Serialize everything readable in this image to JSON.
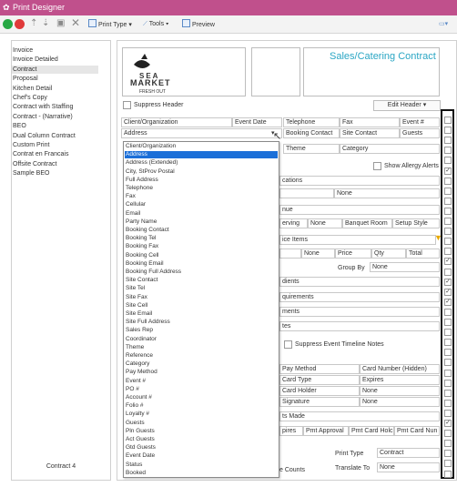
{
  "window": {
    "title": "Print Designer"
  },
  "toolbar": {
    "print_type": "Print Type",
    "tools": "Tools",
    "preview": "Preview"
  },
  "left_panel": {
    "items": [
      "Invoice",
      "Invoice Detailed",
      "Contract",
      "Proposal",
      "Kitchen Detail",
      "Chef's Copy",
      "Contract with Staffing",
      "Contract - (Narrative)",
      "BEO",
      "Dual Column Contract",
      "Custom Print",
      "Contrat en Francais",
      "Offsite Contract",
      "Sample BEO"
    ],
    "selected": "Contract",
    "footer": "Contract 4"
  },
  "header": {
    "logo_line1": "SEA",
    "logo_line2": "MARKET",
    "logo_line3": "FRESH OUT",
    "title": "Sales/Catering Contract",
    "suppress_header": "Suppress Header",
    "edit_header": "Edit Header"
  },
  "grid": {
    "client_org": "Client/Organization",
    "event_date": "Event Date",
    "telephone": "Telephone",
    "fax": "Fax",
    "event_num": "Event #",
    "address": "Address",
    "booking_contact": "Booking Contact",
    "site_contact": "Site Contact",
    "guests": "Guests",
    "theme": "Theme",
    "category": "Category",
    "show_allergy": "Show Allergy Alerts",
    "locations": "cations",
    "none": "None",
    "venue": "nue",
    "serving": "erving",
    "banquet_room": "Banquet Room",
    "setup_style": "Setup Style",
    "invoice_items": "ice Items",
    "price": "Price",
    "qty": "Qty",
    "total": "Total",
    "group_by": "Group By",
    "ingredients": "dients",
    "requirements": "quirements",
    "comments": "ments",
    "notes": "tes",
    "suppress_timeline": "Suppress Event Timeline Notes",
    "pay_method": "Pay Method",
    "card_number_hidden": "Card Number (Hidden)",
    "card_type": "Card Type",
    "expires": "Expires",
    "card_holder": "Card Holder",
    "signature": "Signature",
    "payments_made": "ts Made",
    "expires2": "pires",
    "pmt_approval": "Pmt Approval",
    "pmt_card_holder": "Pmt Card Holc",
    "pmt_card_num": "Pmt Card Nun",
    "print_type": "Print Type",
    "print_type_value": "Contract",
    "translate_to": "Translate To",
    "translate_value": "None",
    "course_counts": "e Counts"
  },
  "dropdown": {
    "highlighted": "Address",
    "options": [
      "Client/Organization",
      "Address",
      "Address (Extended)",
      "City, StProv Postal",
      "Full Address",
      "Telephone",
      "Fax",
      "Cellular",
      "Email",
      "Party Name",
      "Booking Contact",
      "Booking Tel",
      "Booking Fax",
      "Booking Cell",
      "Booking Email",
      "Booking Full Address",
      "Site Contact",
      "Site Tel",
      "Site Fax",
      "Site Cell",
      "Site Email",
      "Site Full Address",
      "Sales Rep",
      "Coordinator",
      "Theme",
      "Reference",
      "Category",
      "Pay Method",
      "Event #",
      "PO #",
      "Account #",
      "Folio #",
      "Loyalty #",
      "Guests",
      "Pln Guests",
      "Act Guests",
      "Gtd Guests",
      "Event Date",
      "Status",
      "Booked"
    ]
  },
  "right_checks": [
    false,
    false,
    false,
    false,
    false,
    true,
    false,
    false,
    false,
    false,
    false,
    false,
    false,
    false,
    true,
    false,
    true,
    true,
    true,
    false,
    false,
    false,
    false,
    false,
    false,
    false,
    false,
    false,
    false,
    false,
    true,
    false,
    false,
    false,
    false,
    false
  ]
}
